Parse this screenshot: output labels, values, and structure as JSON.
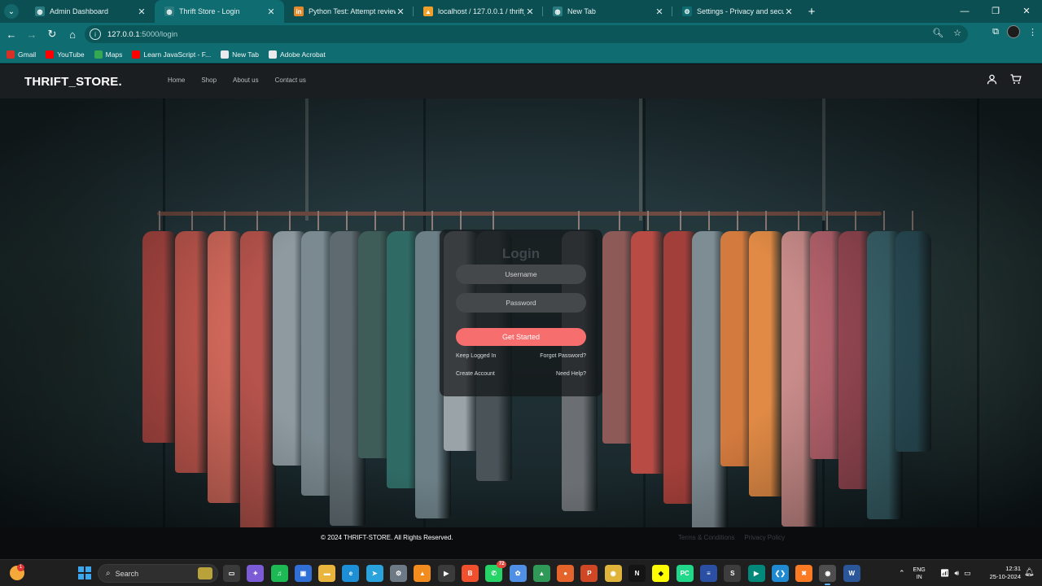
{
  "browser": {
    "tabs": [
      {
        "title": "Admin Dashboard",
        "icon": "globe-icon",
        "color": "#2b7c80",
        "active": false
      },
      {
        "title": "Thrift Store - Login",
        "icon": "globe-icon",
        "color": "#2b7c80",
        "active": true
      },
      {
        "title": "Python Test: Attempt review",
        "icon": "in-logo-icon",
        "color": "#e8892b",
        "active": false
      },
      {
        "title": "localhost / 127.0.0.1 / thrift_sto",
        "icon": "phpmyadmin-icon",
        "color": "#f0a02a",
        "active": false
      },
      {
        "title": "New Tab",
        "icon": "globe-icon",
        "color": "#2b7c80",
        "active": false
      },
      {
        "title": "Settings - Privacy and security",
        "icon": "gear-icon",
        "color": "#0f6c70",
        "active": false
      }
    ],
    "new_tab_symbol": "+",
    "url_host": "127.0.0.1",
    "url_path": ":5000/login",
    "bookmarks": [
      {
        "label": "Gmail",
        "color": "#d93025"
      },
      {
        "label": "YouTube",
        "color": "#ff0000"
      },
      {
        "label": "Maps",
        "color": "#34a853"
      },
      {
        "label": "Learn JavaScript - F...",
        "color": "#ff0000"
      },
      {
        "label": "New Tab",
        "color": "#e8eaed"
      },
      {
        "label": "Adobe Acrobat",
        "color": "#e8eaed"
      }
    ]
  },
  "site": {
    "brand": "THRIFT_STORE.",
    "nav": [
      "Home",
      "Shop",
      "About us",
      "Contact us"
    ],
    "login": {
      "title": "Login",
      "username_placeholder": "Username",
      "password_placeholder": "Password",
      "submit": "Get Started",
      "keep_logged_in": "Keep Logged In",
      "forgot_password": "Forgot Password?",
      "create_account": "Create Account",
      "need_help": "Need Help?"
    },
    "footer": {
      "copyright": "© 2024 THRIFT-STORE. All Rights Reserved.",
      "links": [
        "Terms & Conditions",
        "Privacy Policy"
      ]
    }
  },
  "taskbar": {
    "search_label": "Search",
    "weather_badge": "1",
    "apps": [
      {
        "name": "task-view-icon",
        "color": "#3a3a3a",
        "glyph": "▭"
      },
      {
        "name": "copilot-icon",
        "color": "#7b5cd6",
        "glyph": "✦"
      },
      {
        "name": "spotify-icon",
        "color": "#1db954",
        "glyph": "♫"
      },
      {
        "name": "microsoft-store-icon",
        "color": "#2f6fd6",
        "glyph": "▣"
      },
      {
        "name": "file-explorer-icon",
        "color": "#e9b53c",
        "glyph": "▬"
      },
      {
        "name": "edge-icon",
        "color": "#1c8fd6",
        "glyph": "e"
      },
      {
        "name": "telegram-icon",
        "color": "#2aa3dc",
        "glyph": "➤"
      },
      {
        "name": "settings-icon",
        "color": "#6d7a86",
        "glyph": "⚙"
      },
      {
        "name": "vlc-icon",
        "color": "#f28c1e",
        "glyph": "▲"
      },
      {
        "name": "media-player-icon",
        "color": "#3b3b3b",
        "glyph": "▶"
      },
      {
        "name": "brave-icon",
        "color": "#f0502d",
        "glyph": "B"
      },
      {
        "name": "whatsapp-icon",
        "color": "#25d366",
        "glyph": "✆",
        "badge": "72"
      },
      {
        "name": "photos-icon",
        "color": "#4f8fe6",
        "glyph": "✿"
      },
      {
        "name": "image-viewer-icon",
        "color": "#2f9a57",
        "glyph": "▲"
      },
      {
        "name": "firefox-icon",
        "color": "#e5642b",
        "glyph": "●"
      },
      {
        "name": "powerpoint-icon",
        "color": "#d04726",
        "glyph": "P"
      },
      {
        "name": "chrome-icon",
        "color": "#e0b33a",
        "glyph": "◉"
      },
      {
        "name": "netflix-icon",
        "color": "#141414",
        "glyph": "N"
      },
      {
        "name": "snapchat-icon",
        "color": "#fffc00",
        "glyph": "◆"
      },
      {
        "name": "pycharm-icon",
        "color": "#21d789",
        "glyph": "PC"
      },
      {
        "name": "news-icon",
        "color": "#2a4fa3",
        "glyph": "≡"
      },
      {
        "name": "sublime-icon",
        "color": "#3d3d3d",
        "glyph": "S"
      },
      {
        "name": "meet-icon",
        "color": "#00897b",
        "glyph": "▶"
      },
      {
        "name": "vscode-icon",
        "color": "#1f8ad2",
        "glyph": "❮❯"
      },
      {
        "name": "xampp-icon",
        "color": "#fb7a24",
        "glyph": "✖"
      },
      {
        "name": "chrome-active-icon",
        "color": "#4e4e4e",
        "glyph": "◉",
        "active": true
      },
      {
        "name": "word-icon",
        "color": "#2b579a",
        "glyph": "W"
      }
    ],
    "lang_top": "ENG",
    "lang_bottom": "IN",
    "time": "12:31",
    "date": "25-10-2024"
  }
}
